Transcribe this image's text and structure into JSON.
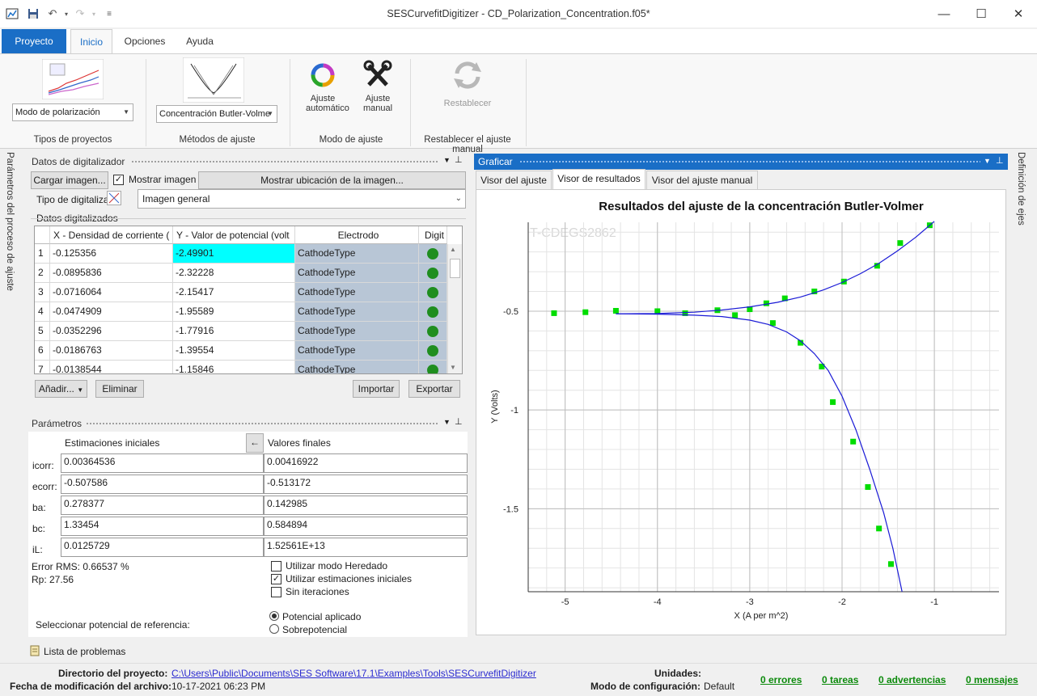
{
  "window": {
    "title": "SESCurvefitDigitizer - CD_Polarization_Concentration.f05*"
  },
  "ribbon": {
    "tabs": [
      "Proyecto",
      "Inicio",
      "Opciones",
      "Ayuda"
    ],
    "project_type_value": "Modo de polarización",
    "project_type_group": "Tipos de proyectos",
    "fit_method_value": "Concentración Butler-Volme",
    "fit_method_group": "Métodos de ajuste",
    "auto_fit_label": "Ajuste automático",
    "manual_fit_label": "Ajuste manual",
    "fit_mode_group": "Modo de ajuste",
    "reset_label": "Restablecer",
    "reset_group": "Restablecer el ajuste manual"
  },
  "side": {
    "left_tab": "Parámetros del proceso de ajuste",
    "right_tab": "Definición de ejes"
  },
  "digitizer": {
    "title": "Datos de digitalizador",
    "load_image": "Cargar imagen...",
    "show_image": "Mostrar imagen",
    "show_location": "Mostrar ubicación de la imagen...",
    "digitize_type_label": "Tipo de digitalizar",
    "digitize_type_value": "Imagen general",
    "data_label": "Datos digitalizados",
    "columns": [
      "X - Densidad de corriente (",
      "Y - Valor de potencial (volt",
      "Electrodo",
      "Digit"
    ],
    "rows": [
      {
        "n": "1",
        "x": "-0.125356",
        "y": "-2.49901",
        "e": "CathodeType"
      },
      {
        "n": "2",
        "x": "-0.0895836",
        "y": "-2.32228",
        "e": "CathodeType"
      },
      {
        "n": "3",
        "x": "-0.0716064",
        "y": "-2.15417",
        "e": "CathodeType"
      },
      {
        "n": "4",
        "x": "-0.0474909",
        "y": "-1.95589",
        "e": "CathodeType"
      },
      {
        "n": "5",
        "x": "-0.0352296",
        "y": "-1.77916",
        "e": "CathodeType"
      },
      {
        "n": "6",
        "x": "-0.0186763",
        "y": "-1.39554",
        "e": "CathodeType"
      },
      {
        "n": "7",
        "x": "-0.0138544",
        "y": "-1.15846",
        "e": "CathodeType"
      }
    ],
    "add": "Añadir...",
    "delete": "Eliminar",
    "import": "Importar",
    "export": "Exportar"
  },
  "params": {
    "title": "Parámetros",
    "col_initial": "Estimaciones iniciales",
    "col_final": "Valores finales",
    "rows": [
      {
        "label": "icorr:",
        "initial": "0.00364536",
        "final": "0.00416922"
      },
      {
        "label": "ecorr:",
        "initial": "-0.507586",
        "final": "-0.513172"
      },
      {
        "label": "ba:",
        "initial": "0.278377",
        "final": "0.142985"
      },
      {
        "label": "bc:",
        "initial": "1.33454",
        "final": "0.584894"
      },
      {
        "label": "iL:",
        "initial": "0.0125729",
        "final": "1.52561E+13"
      }
    ],
    "rms": "Error RMS: 0.66537 %",
    "rp": "Rp: 27.56",
    "inherit_mode": "Utilizar modo Heredado",
    "use_initial": "Utilizar estimaciones iniciales",
    "no_iter": "Sin iteraciones",
    "ref_label": "Seleccionar potencial de referencia:",
    "applied": "Potencial aplicado",
    "over": "Sobrepotencial"
  },
  "problems": "Lista de problemas",
  "plot_panel": {
    "title": "Graficar",
    "tabs": [
      "Visor del ajuste",
      "Visor de resultados",
      "Visor del ajuste manual"
    ],
    "watermark": "T-CDEGS2862"
  },
  "chart_data": {
    "type": "scatter",
    "title": "Resultados del ajuste de la concentración Butler-Volmer",
    "xlabel": "X (A per m^2)",
    "ylabel": "Y (Volts)",
    "xlim": [
      -5.4,
      -0.3
    ],
    "ylim": [
      -1.92,
      -0.05
    ],
    "xticks": [
      -5,
      -4,
      -3,
      -2,
      -1
    ],
    "yticks": [
      -0.5,
      -1,
      -1.5
    ],
    "grid": true,
    "series": [
      {
        "kind": "points",
        "color": "#00dd00",
        "x": [
          -5.12,
          -4.78,
          -4.45,
          -4.0,
          -3.7,
          -3.35,
          -3.16,
          -3.0,
          -2.82,
          -2.62,
          -2.3,
          -1.98,
          -1.62,
          -1.37,
          -1.05,
          -2.75,
          -2.45,
          -2.22,
          -2.1,
          -1.88,
          -1.72,
          -1.6,
          -1.47
        ],
        "y": [
          -0.51,
          -0.505,
          -0.498,
          -0.5,
          -0.51,
          -0.495,
          -0.52,
          -0.49,
          -0.46,
          -0.435,
          -0.4,
          -0.35,
          -0.27,
          -0.155,
          -0.065,
          -0.56,
          -0.66,
          -0.78,
          -0.96,
          -1.16,
          -1.39,
          -1.6,
          -1.78
        ]
      },
      {
        "kind": "line",
        "color": "#1a1ad6",
        "x": [
          -4.45,
          -4.0,
          -3.6,
          -3.3,
          -3.0,
          -2.7,
          -2.45,
          -2.2,
          -2.0,
          -1.8,
          -1.6,
          -1.4,
          -1.2,
          -1.0
        ],
        "y": [
          -0.513,
          -0.512,
          -0.505,
          -0.494,
          -0.478,
          -0.455,
          -0.428,
          -0.392,
          -0.355,
          -0.31,
          -0.258,
          -0.195,
          -0.125,
          -0.045
        ]
      },
      {
        "kind": "line",
        "color": "#1a1ad6",
        "x": [
          -4.45,
          -4.0,
          -3.6,
          -3.3,
          -3.0,
          -2.8,
          -2.6,
          -2.45,
          -2.3,
          -2.15,
          -2.0,
          -1.85,
          -1.7,
          -1.55,
          -1.45,
          -1.35
        ],
        "y": [
          -0.513,
          -0.515,
          -0.52,
          -0.527,
          -0.545,
          -0.567,
          -0.605,
          -0.65,
          -0.715,
          -0.8,
          -0.93,
          -1.1,
          -1.3,
          -1.52,
          -1.7,
          -1.92
        ]
      }
    ]
  },
  "status": {
    "project_dir_label": "Directorio del proyecto:",
    "project_dir": "C:\\Users\\Public\\Documents\\SES Software\\17.1\\Examples\\Tools\\SESCurvefitDigitizer",
    "modified_label": "Fecha de modificación del archivo:",
    "modified": "10-17-2021 06:23 PM",
    "units_label": "Unidades:",
    "config_label": "Modo de configuración:",
    "config": "Default",
    "errors": "0 errores",
    "tasks": "0 tareas",
    "warnings": "0 advertencias",
    "messages": "0 mensajes"
  }
}
